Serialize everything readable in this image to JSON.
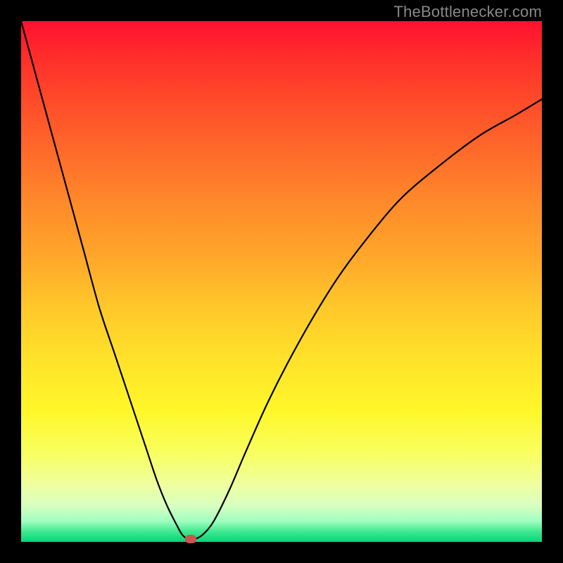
{
  "attribution": "TheBottlenecker.com",
  "colors": {
    "frame": "#000000",
    "curve_stroke": "#000000",
    "marker_fill": "#c25a52",
    "attribution_text": "#888888"
  },
  "chart_data": {
    "type": "line",
    "title": "",
    "xlabel": "",
    "ylabel": "",
    "xlim": [
      0,
      100
    ],
    "ylim": [
      0,
      100
    ],
    "legend": false,
    "grid": false,
    "series": [
      {
        "name": "bottleneck-curve",
        "x": [
          0,
          3,
          6,
          9,
          12,
          15,
          18,
          21,
          24,
          26,
          28,
          30,
          31,
          32,
          33.5,
          35,
          37,
          40,
          43,
          47,
          51,
          56,
          61,
          67,
          73,
          80,
          88,
          95,
          100
        ],
        "y": [
          100,
          89,
          78,
          67,
          56,
          45,
          36,
          27,
          18,
          12,
          7,
          3,
          1.3,
          0.6,
          0.6,
          1.5,
          4,
          10,
          17,
          26,
          34,
          43,
          51,
          59,
          66,
          72,
          78,
          82,
          85
        ]
      }
    ],
    "annotations": [
      {
        "name": "minimum-marker",
        "x": 32.5,
        "y": 0.5
      }
    ],
    "background": {
      "type": "vertical-gradient",
      "stops": [
        {
          "pos": 0.0,
          "color": "#ff1030"
        },
        {
          "pos": 0.5,
          "color": "#ffbf2a"
        },
        {
          "pos": 0.8,
          "color": "#fff72a"
        },
        {
          "pos": 1.0,
          "color": "#00d878"
        }
      ]
    }
  }
}
